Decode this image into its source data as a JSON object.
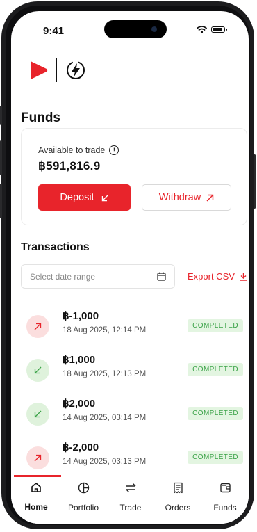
{
  "status_bar": {
    "time": "9:41"
  },
  "page": {
    "title": "Funds"
  },
  "balance": {
    "label": "Available to trade",
    "amount": "฿591,816.9",
    "deposit_label": "Deposit",
    "withdraw_label": "Withdraw"
  },
  "transactions": {
    "title": "Transactions",
    "date_placeholder": "Select date range",
    "export_label": "Export CSV",
    "items": [
      {
        "direction": "out",
        "amount": "฿-1,000",
        "date": "18 Aug 2025, 12:14 PM",
        "status": "COMPLETED"
      },
      {
        "direction": "in",
        "amount": "฿1,000",
        "date": "18 Aug 2025, 12:13 PM",
        "status": "COMPLETED"
      },
      {
        "direction": "in",
        "amount": "฿2,000",
        "date": "14 Aug 2025, 03:14 PM",
        "status": "COMPLETED"
      },
      {
        "direction": "out",
        "amount": "฿-2,000",
        "date": "14 Aug 2025, 03:13 PM",
        "status": "COMPLETED"
      }
    ]
  },
  "nav": {
    "items": [
      {
        "label": "Home",
        "icon": "home-icon",
        "active": true
      },
      {
        "label": "Portfolio",
        "icon": "portfolio-icon",
        "active": false
      },
      {
        "label": "Trade",
        "icon": "trade-icon",
        "active": false
      },
      {
        "label": "Orders",
        "icon": "orders-icon",
        "active": false
      },
      {
        "label": "Funds",
        "icon": "funds-icon",
        "active": false
      }
    ]
  },
  "colors": {
    "accent": "#e8242b",
    "success": "#3aa247",
    "success_bg": "#e3f5e1"
  }
}
